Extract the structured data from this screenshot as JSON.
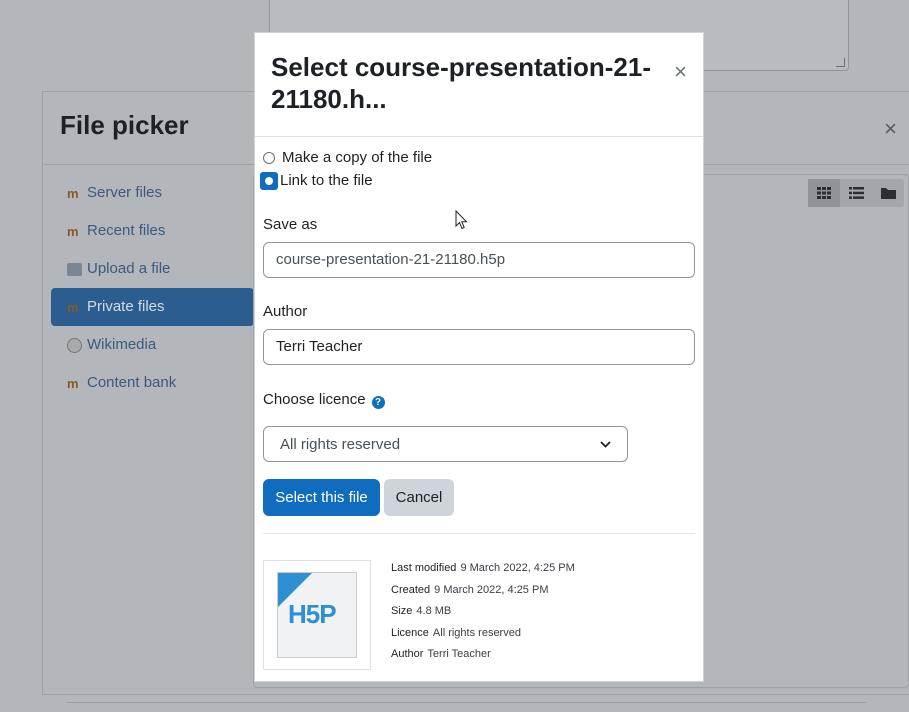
{
  "background": {
    "file_picker_title": "File picker",
    "close_glyph": "×",
    "nav_items": [
      {
        "label": "Server files",
        "icon": "moodle-icon"
      },
      {
        "label": "Recent files",
        "icon": "moodle-icon"
      },
      {
        "label": "Upload a file",
        "icon": "upload-icon"
      },
      {
        "label": "Private files",
        "icon": "moodle-icon",
        "active": true
      },
      {
        "label": "Wikimedia",
        "icon": "wikimedia-icon"
      },
      {
        "label": "Content bank",
        "icon": "moodle-icon"
      }
    ]
  },
  "dialog": {
    "title": "Select course-presentation-21-21180.h...",
    "close_glyph": "×",
    "options": {
      "copy_label": "Make a copy of the file",
      "link_label": "Link to the file",
      "selected": "link"
    },
    "save_as_label": "Save as",
    "save_as_value": "course-presentation-21-21180.h5p",
    "author_label": "Author",
    "author_value": "Terri Teacher",
    "licence_label": "Choose licence",
    "licence_value": "All rights reserved",
    "select_button": "Select this file",
    "cancel_button": "Cancel",
    "thumbnail_logo": "H5P",
    "details": {
      "modified_label": "Last modified",
      "modified_value": "9 March 2022, 4:25 PM",
      "created_label": "Created",
      "created_value": "9 March 2022, 4:25 PM",
      "size_label": "Size",
      "size_value": "4.8 MB",
      "licence_label": "Licence",
      "licence_value": "All rights reserved",
      "author_label": "Author",
      "author_value": "Terri Teacher"
    }
  },
  "colors": {
    "primary": "#0f6cbf",
    "overlay": "#b3b6ba",
    "active_nav": "#2c5d91"
  }
}
